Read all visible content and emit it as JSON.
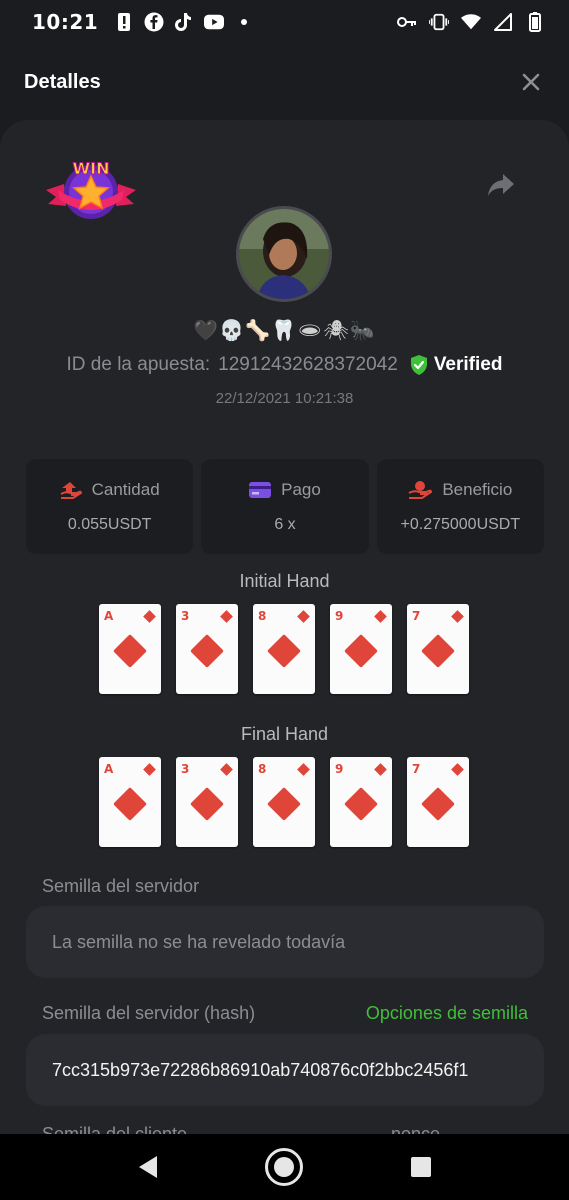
{
  "status_bar": {
    "time": "10:21",
    "left_icons": [
      "alert-icon",
      "facebook-icon",
      "tiktok-icon",
      "youtube-icon",
      "dot-icon"
    ],
    "right_icons": [
      "vpn-key-icon",
      "vibrate-icon",
      "wifi-icon",
      "signal-icon",
      "battery-icon"
    ]
  },
  "header": {
    "title": "Detalles",
    "close_icon": "close-icon"
  },
  "bet": {
    "badge_text": "WIN",
    "emoji_line": "🖤💀🦴🦷🕳🕷🐜",
    "id_label": "ID de la apuesta:",
    "id_value": "12912432628372042",
    "verified_label": "Verified",
    "date": "22/12/2021 10:21:38"
  },
  "stats": [
    {
      "icon": "wallet-hand-icon",
      "label": "Cantidad",
      "value": "0.055USDT",
      "color": "#e0453a"
    },
    {
      "icon": "card-icon",
      "label": "Pago",
      "value": "6 x",
      "color": "#7b4fe0"
    },
    {
      "icon": "profit-hand-icon",
      "label": "Beneficio",
      "value": "+0.275000USDT",
      "color": "#e0453a"
    }
  ],
  "initial_hand": {
    "title": "Initial Hand",
    "cards": [
      {
        "rank": "A",
        "suit": "diamonds"
      },
      {
        "rank": "3",
        "suit": "diamonds"
      },
      {
        "rank": "8",
        "suit": "diamonds"
      },
      {
        "rank": "9",
        "suit": "diamonds"
      },
      {
        "rank": "7",
        "suit": "diamonds"
      }
    ]
  },
  "final_hand": {
    "title": "Final Hand",
    "cards": [
      {
        "rank": "A",
        "suit": "diamonds"
      },
      {
        "rank": "3",
        "suit": "diamonds"
      },
      {
        "rank": "8",
        "suit": "diamonds"
      },
      {
        "rank": "9",
        "suit": "diamonds"
      },
      {
        "rank": "7",
        "suit": "diamonds"
      }
    ]
  },
  "server_seed": {
    "label": "Semilla del servidor",
    "value": "La semilla no se ha revelado todavía"
  },
  "server_seed_hash": {
    "label": "Semilla del servidor (hash)",
    "link": "Opciones de semilla",
    "value": "7cc315b973e72286b86910ab740876c0f2bbc2456f1"
  },
  "client_seed": {
    "label": "Semilla del cliente",
    "nonce_label": "nonce"
  },
  "colors": {
    "accent_green": "#3fbf3a",
    "suit_red": "#e0453a",
    "background": "#1b1c1f",
    "sheet": "#232428"
  }
}
